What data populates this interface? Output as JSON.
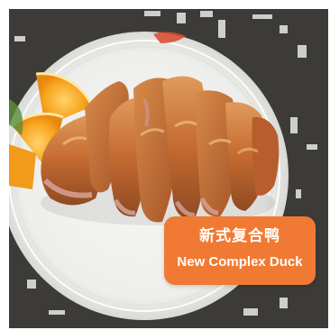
{
  "dish_label": {
    "name_zh": "新式复合鸭",
    "name_en": "New Complex Duck"
  },
  "colors": {
    "tag_background": "#f07a34",
    "tag_text": "#ffffff",
    "tabletop": "#3d3b38",
    "plate": "#f2f2f0",
    "duck_skin": "#c9723a",
    "orange_slice": "#f59a1c"
  }
}
